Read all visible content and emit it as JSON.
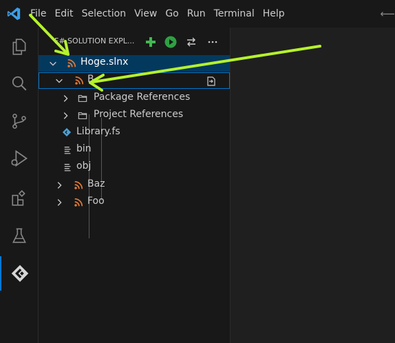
{
  "titlebar": {
    "logo_icon": "vscode-logo-icon",
    "menu": [
      "File",
      "Edit",
      "Selection",
      "View",
      "Go",
      "Run",
      "Terminal",
      "Help"
    ],
    "nav_back_icon": "arrow-left-icon"
  },
  "activitybar": {
    "items": [
      {
        "name": "explorer",
        "icon": "files-icon"
      },
      {
        "name": "search",
        "icon": "search-icon"
      },
      {
        "name": "source-control",
        "icon": "source-control-icon"
      },
      {
        "name": "run-debug",
        "icon": "run-debug-icon"
      },
      {
        "name": "extensions",
        "icon": "extensions-icon"
      },
      {
        "name": "testing",
        "icon": "beaker-icon"
      },
      {
        "name": "solution-explorer",
        "icon": "ionide-icon",
        "active": true
      }
    ]
  },
  "sidebar": {
    "title_prefix": "F#",
    "title": "SOLUTION EXPL...",
    "actions": [
      "add-icon",
      "run-icon",
      "sync-icon",
      "more-icon"
    ],
    "tree": [
      {
        "label": "Hoge.slnx",
        "icon": "rss-icon",
        "expanded": true,
        "selected": true
      },
      {
        "label": "B",
        "icon": "rss-icon",
        "expanded": true,
        "focused": true,
        "action_icon": "go-to-file-icon"
      },
      {
        "label": "Package References",
        "icon": "folder-icon",
        "expanded": false
      },
      {
        "label": "Project References",
        "icon": "folder-icon",
        "expanded": false
      },
      {
        "label": "Library.fs",
        "icon": "fsharp-file-icon"
      },
      {
        "label": "bin",
        "icon": "list-icon"
      },
      {
        "label": "obj",
        "icon": "list-icon"
      },
      {
        "label": "Baz",
        "icon": "rss-icon",
        "expanded": false
      },
      {
        "label": "Foo",
        "icon": "rss-icon",
        "expanded": false
      }
    ]
  },
  "colors": {
    "accent": "#0078d4",
    "selection": "#04395e",
    "project_icon": "#e37933",
    "annotation_arrow": "#b5f22c"
  }
}
